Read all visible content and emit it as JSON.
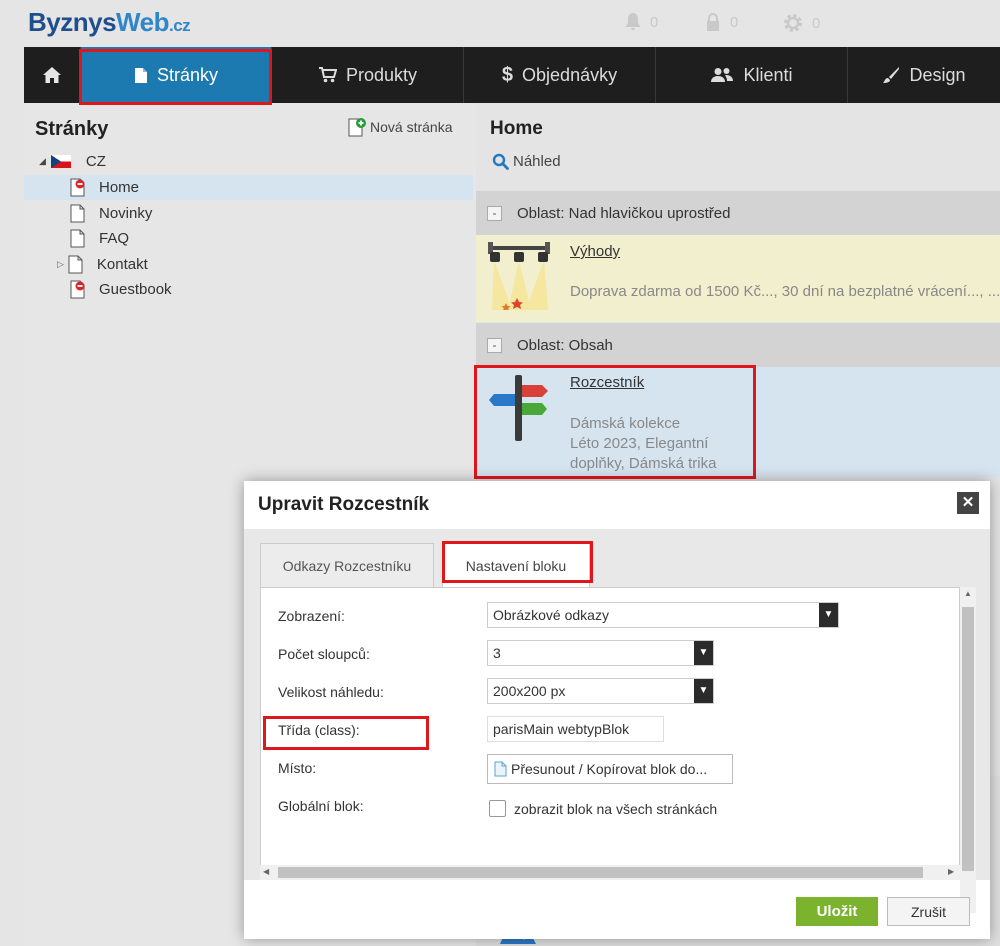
{
  "brand": {
    "part1": "Byznys",
    "part2": "Web",
    "part3": ".cz"
  },
  "top_indicators": [
    {
      "icon": "bell-icon",
      "count": "0"
    },
    {
      "icon": "lock-icon",
      "count": "0"
    },
    {
      "icon": "gear-icon",
      "count": "0"
    }
  ],
  "nav": {
    "home_icon": "home-icon",
    "items": [
      {
        "label": "Stránky",
        "icon": "page-icon",
        "active": true
      },
      {
        "label": "Produkty",
        "icon": "cart-icon"
      },
      {
        "label": "Objednávky",
        "icon": "dollar-icon"
      },
      {
        "label": "Klienti",
        "icon": "users-icon"
      },
      {
        "label": "Design",
        "icon": "brush-icon"
      }
    ]
  },
  "pages": {
    "title": "Stránky",
    "new_page_label": "Nová stránka",
    "tree": {
      "root": "CZ",
      "items": [
        {
          "label": "Home",
          "selected": true,
          "icon": "page-red-icon"
        },
        {
          "label": "Novinky",
          "icon": "page-icon"
        },
        {
          "label": "FAQ",
          "icon": "page-icon"
        },
        {
          "label": "Kontakt",
          "icon": "page-icon",
          "expandable": true
        },
        {
          "label": "Guestbook",
          "icon": "page-red-icon"
        }
      ]
    }
  },
  "content": {
    "title": "Home",
    "preview_label": "Náhled",
    "area1": {
      "label": "Oblast: Nad hlavičkou uprostřed"
    },
    "block1": {
      "title": "Výhody",
      "desc": "Doprava zdarma od 1500 Kč..., 30 dní na bezplatné vrácení..., ..."
    },
    "area2": {
      "label": "Oblast: Obsah"
    },
    "block2": {
      "title": "Rozcestník",
      "desc_lines": [
        "Dámská kolekce",
        "Léto 2023, Elegantní",
        "doplňky, Dámská trika"
      ]
    }
  },
  "modal": {
    "title": "Upravit Rozcestník",
    "close_icon": "close-icon",
    "tabs": [
      "Odkazy Rozcestníku",
      "Nastavení bloku"
    ],
    "fields": {
      "display": {
        "label": "Zobrazení:",
        "value": "Obrázkové odkazy"
      },
      "columns": {
        "label": "Počet sloupců:",
        "value": "3"
      },
      "thumb": {
        "label": "Velikost náhledu:",
        "value": "200x200 px"
      },
      "class": {
        "label": "Třída (class):",
        "value": "parisMain webtypBlok"
      },
      "place": {
        "label": "Místo:",
        "button": "Přesunout / Kopírovat blok do..."
      },
      "global": {
        "label": "Globální blok:",
        "checkbox": "zobrazit blok na všech stránkách",
        "checked": false
      }
    },
    "save": "Uložit",
    "cancel": "Zrušit"
  },
  "colors": {
    "nav_bg": "#1e1e1e",
    "nav_active": "#1c7ab0",
    "highlight": "#e0161d",
    "save_btn": "#7bb32e"
  }
}
